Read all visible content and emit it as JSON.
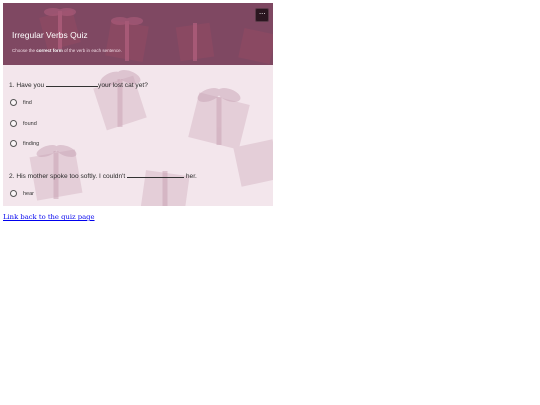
{
  "quiz": {
    "title": "Irregular Verbs Quiz",
    "instruction": {
      "before": "Choose the ",
      "bold": "correct form",
      "after": " of the verb in each sentence."
    },
    "menu_label": "···",
    "questions": [
      {
        "prefix": "1. Have you ",
        "suffix": "your lost cat yet?",
        "options": [
          "find",
          "found",
          "finding"
        ]
      },
      {
        "prefix": "2. His mother spoke too softly. I couldn't ",
        "suffix": " her.",
        "options": [
          "hear"
        ]
      }
    ]
  },
  "links": {
    "back": "Link back to the quiz page"
  },
  "colors": {
    "header": "#6e324e",
    "panel_bg": "#f3e6ec",
    "gift": "#8e4a63",
    "link": "#0000ee"
  }
}
